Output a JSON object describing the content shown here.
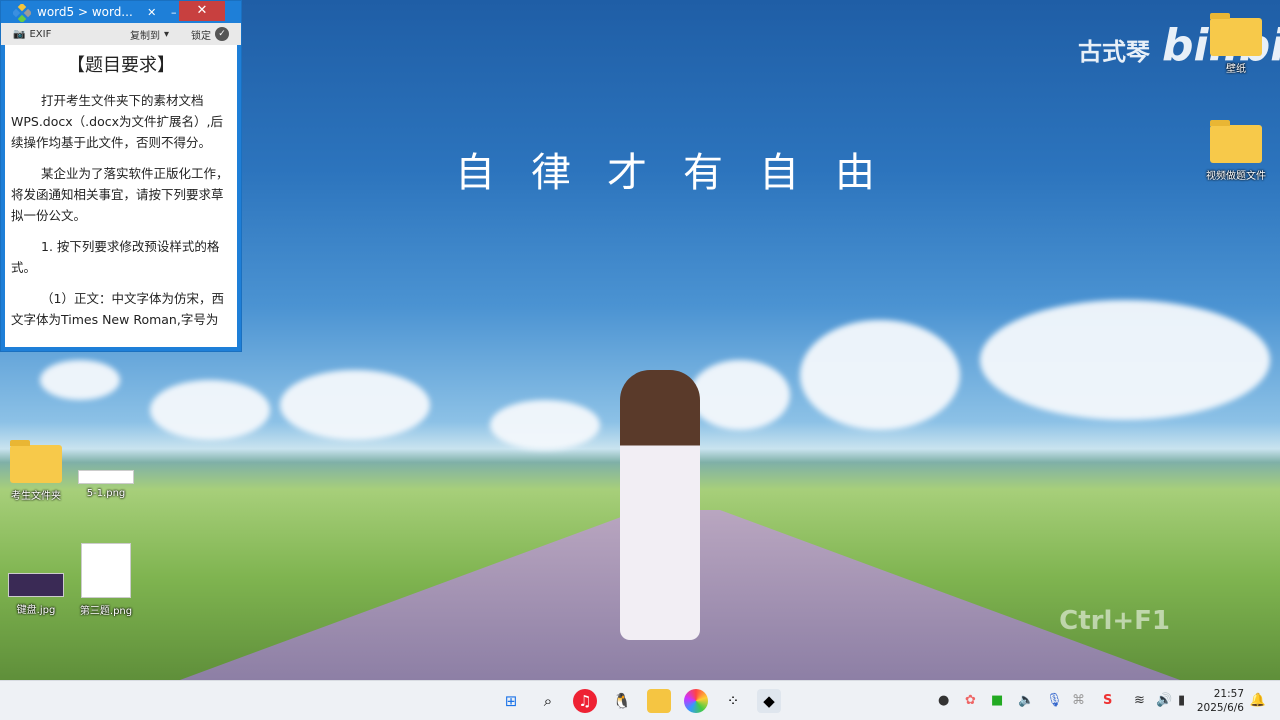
{
  "window": {
    "title": "word5 > word...",
    "toolbar": {
      "exif": "EXIF",
      "copy_to": "复制到",
      "lock": "锁定"
    },
    "doc": {
      "heading": "【题目要求】",
      "paragraphs": [
        "打开考生文件夹下的素材文档WPS.docx（.docx为文件扩展名）,后续操作均基于此文件，否则不得分。",
        "某企业为了落实软件正版化工作，将发函通知相关事宜，请按下列要求草拟一份公文。",
        "1. 按下列要求修改预设样式的格式。",
        "（1）正文：中文字体为仿宋，西文字体为Times New Roman,字号为"
      ]
    }
  },
  "wallpaper": {
    "slogan": "自律才有自由",
    "brand": "古式琴",
    "bili": "bilibili",
    "watermark": "Ctrl+F1"
  },
  "desktop_icons": [
    {
      "label": "考生文件夹"
    },
    {
      "label": "5-1.png"
    },
    {
      "label": "键盘.jpg"
    },
    {
      "label": "第三题.png"
    },
    {
      "label": "壁纸"
    },
    {
      "label": "视频做题文件"
    }
  ],
  "taskbar": {
    "time": "21:57",
    "date": "2025/6/6"
  }
}
